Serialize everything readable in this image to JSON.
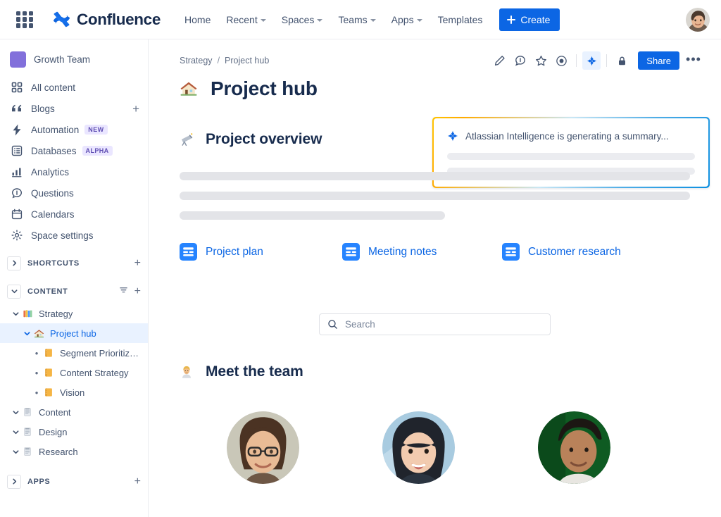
{
  "topnav": {
    "app_switcher_icon": "grid-apps-icon",
    "brand": "Confluence",
    "links": [
      {
        "label": "Home",
        "has_caret": false
      },
      {
        "label": "Recent",
        "has_caret": true
      },
      {
        "label": "Spaces",
        "has_caret": true
      },
      {
        "label": "Teams",
        "has_caret": true
      },
      {
        "label": "Apps",
        "has_caret": true
      },
      {
        "label": "Templates",
        "has_caret": false
      }
    ],
    "create_label": "Create",
    "create_color": "#0C66E4",
    "avatar_name": "user-profile-avatar"
  },
  "sidebar": {
    "space": {
      "name": "Growth Team",
      "color": "#8270DB"
    },
    "nav": [
      {
        "label": "All content",
        "icon": "all-content-icon",
        "badge": null,
        "plus": false
      },
      {
        "label": "Blogs",
        "icon": "blogs-quote-icon",
        "badge": null,
        "plus": true
      },
      {
        "label": "Automation",
        "icon": "automation-bolt-icon",
        "badge": "NEW",
        "plus": false
      },
      {
        "label": "Databases",
        "icon": "databases-icon",
        "badge": "ALPHA",
        "plus": false
      },
      {
        "label": "Analytics",
        "icon": "analytics-bars-icon",
        "badge": null,
        "plus": false
      },
      {
        "label": "Questions",
        "icon": "questions-chat-icon",
        "badge": null,
        "plus": false
      },
      {
        "label": "Calendars",
        "icon": "calendar-icon",
        "badge": null,
        "plus": false
      },
      {
        "label": "Space settings",
        "icon": "gear-icon",
        "badge": null,
        "plus": false
      }
    ],
    "shortcuts_section": {
      "title": "SHORTCUTS",
      "expanded": false,
      "add_label": "+"
    },
    "content_section": {
      "title": "CONTENT",
      "expanded": true,
      "add_label": "+",
      "filter_label": "filter-icon"
    },
    "tree": [
      {
        "label": "Strategy",
        "emoji": "books",
        "depth": 0,
        "expanded": true,
        "active": false,
        "bullet": false
      },
      {
        "label": "Project hub",
        "emoji": "house",
        "depth": 1,
        "expanded": true,
        "active": true,
        "bullet": false
      },
      {
        "label": "Segment Prioritization",
        "emoji": "notebook",
        "depth": 2,
        "expanded": null,
        "active": false,
        "bullet": true
      },
      {
        "label": "Content Strategy",
        "emoji": "notebook",
        "depth": 2,
        "expanded": null,
        "active": false,
        "bullet": true
      },
      {
        "label": "Vision",
        "emoji": "notebook",
        "depth": 2,
        "expanded": null,
        "active": false,
        "bullet": true
      },
      {
        "label": "Content",
        "emoji": "page",
        "depth": 0,
        "expanded": true,
        "active": false,
        "bullet": false
      },
      {
        "label": "Design",
        "emoji": "page",
        "depth": 0,
        "expanded": true,
        "active": false,
        "bullet": false
      },
      {
        "label": "Research",
        "emoji": "page",
        "depth": 0,
        "expanded": true,
        "active": false,
        "bullet": false
      }
    ],
    "apps_section": {
      "title": "APPS",
      "expanded": false,
      "add_label": "+"
    }
  },
  "page": {
    "breadcrumb": {
      "space": "Strategy",
      "separator": "/",
      "current": "Project hub"
    },
    "actions": [
      {
        "name": "edit-pencil-icon",
        "active": false
      },
      {
        "name": "comment-icon",
        "active": false
      },
      {
        "name": "star-icon",
        "active": false
      },
      {
        "name": "watch-eye-icon",
        "active": false
      },
      {
        "name": "atlassian-intelligence-icon",
        "active": true
      }
    ],
    "restrictions_icon": "lock-icon",
    "share_label": "Share",
    "more_label": "•••",
    "title": "Project hub",
    "title_emoji": "house",
    "section_heading": "Project overview",
    "section_emoji": "telescope",
    "body_skeletons": [
      100,
      100,
      52
    ],
    "link_cards": [
      {
        "label": "Project plan",
        "icon": "page-blue-icon"
      },
      {
        "label": "Meeting notes",
        "icon": "page-blue-icon"
      },
      {
        "label": "Customer research",
        "icon": "page-blue-icon"
      }
    ],
    "search": {
      "placeholder": "Search",
      "value": "",
      "icon": "search-icon"
    },
    "team_heading": "Meet the team",
    "team_emoji": "person-blond",
    "team": [
      {
        "name": "team-avatar-1"
      },
      {
        "name": "team-avatar-2"
      },
      {
        "name": "team-avatar-3"
      }
    ]
  },
  "ai_panel": {
    "icon": "atlassian-intelligence-icon",
    "message": "Atlassian Intelligence is generating a summary...",
    "skeleton_widths": [
      100,
      100
    ]
  }
}
